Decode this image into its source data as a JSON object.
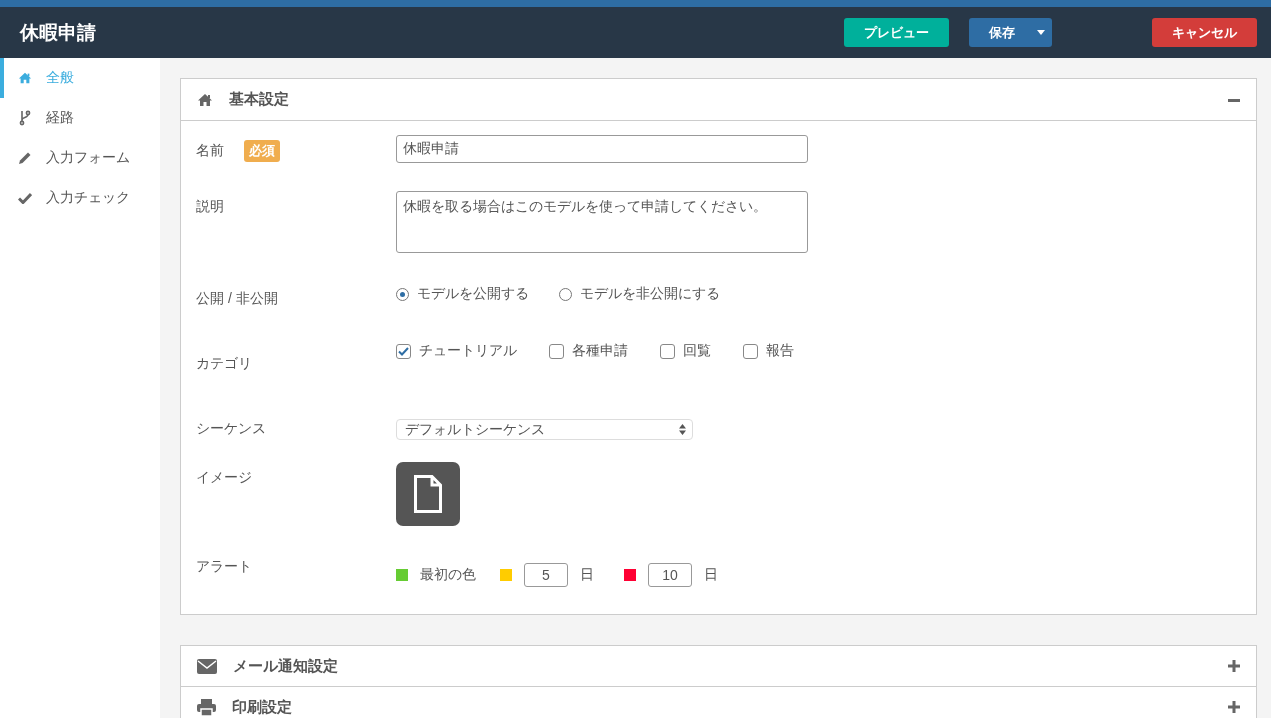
{
  "header": {
    "title": "休暇申請",
    "buttons": [
      {
        "label": "プレビュー",
        "kind": "preview"
      },
      {
        "label": "保存",
        "kind": "split"
      },
      {
        "label": "キャンセル",
        "kind": "cancel"
      }
    ]
  },
  "sidebar": {
    "items": [
      {
        "label": "全般",
        "selected": true
      },
      {
        "label": "経路",
        "selected": false
      },
      {
        "label": "入力フォーム",
        "selected": false
      },
      {
        "label": "入力チェック",
        "selected": false
      }
    ]
  },
  "basic_settings": {
    "title": "基本設定",
    "expanded": true,
    "name": {
      "label": "名前",
      "badge": "必須",
      "value": "休暇申請"
    },
    "description": {
      "label": "説明",
      "value": "休暇を取る場合はこのモデルを使って申請してください。"
    },
    "visibility": {
      "label": "公開 / 非公開",
      "options": [
        {
          "label": "モデルを公開する",
          "selected": true
        },
        {
          "label": "モデルを非公開にする",
          "selected": false
        }
      ]
    },
    "category": {
      "label": "カテゴリ",
      "options": [
        {
          "label": "チュートリアル",
          "checked": true
        },
        {
          "label": "各種申請",
          "checked": false
        },
        {
          "label": "回覧",
          "checked": false
        },
        {
          "label": "報告",
          "checked": false
        }
      ]
    },
    "sequence": {
      "label": "シーケンス",
      "value": "デフォルトシーケンス"
    },
    "image": {
      "label": "イメージ"
    },
    "alert": {
      "label": "アラート",
      "levels": [
        {
          "kind": "label",
          "color": "#66cc33",
          "text": "最初の色"
        },
        {
          "kind": "days",
          "color": "#ffcc00",
          "value": "5",
          "unit": "日"
        },
        {
          "kind": "days",
          "color": "#ff0033",
          "value": "10",
          "unit": "日"
        }
      ]
    }
  },
  "sections": [
    {
      "title": "メール通知設定",
      "expanded": false
    },
    {
      "title": "印刷設定",
      "expanded": false
    }
  ]
}
